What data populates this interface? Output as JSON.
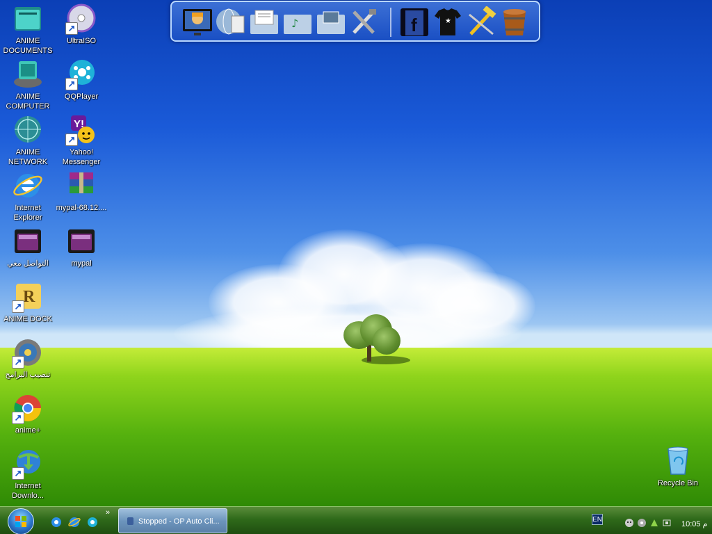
{
  "desktop": {
    "icons_col1": [
      {
        "label": "ANIME DOCUMENTS",
        "icon": "folder-icon"
      },
      {
        "label": "ANIME COMPUTER",
        "icon": "computer-icon"
      },
      {
        "label": "ANIME NETWORK",
        "icon": "network-globe-icon"
      },
      {
        "label": "Internet Explorer",
        "icon": "internet-explorer-icon"
      },
      {
        "label": "التواصل معي",
        "icon": "dark-folder-icon"
      },
      {
        "label": "ANIME DOCK",
        "icon": "rocketdock-icon"
      },
      {
        "label": "تنصيب البرامج",
        "icon": "installer-icon"
      },
      {
        "label": "anime+",
        "icon": "chrome-icon"
      },
      {
        "label": "Internet Downlo...",
        "icon": "internet-download-manager-icon"
      }
    ],
    "icons_col2": [
      {
        "label": "UltraISO",
        "icon": "disc-icon"
      },
      {
        "label": "QQPlayer",
        "icon": "film-reel-icon"
      },
      {
        "label": "Yahoo! Messenger",
        "icon": "yahoo-messenger-icon"
      },
      {
        "label": "mypal-68.12....",
        "icon": "winrar-archive-icon"
      },
      {
        "label": "mypal",
        "icon": "dark-folder-icon"
      }
    ],
    "recycle_bin": {
      "label": "Recycle Bin",
      "icon": "recycle-bin-icon"
    }
  },
  "dock": {
    "items": [
      {
        "icon": "anime-computer-icon"
      },
      {
        "icon": "globe-documents-icon"
      },
      {
        "icon": "documents-folder-icon"
      },
      {
        "icon": "music-folder-icon"
      },
      {
        "icon": "pictures-folder-icon"
      },
      {
        "icon": "tools-icon"
      },
      {
        "icon": "facebook-icon"
      },
      {
        "icon": "tshirt-icon"
      },
      {
        "icon": "hammer-icon"
      },
      {
        "icon": "bucket-icon"
      }
    ]
  },
  "taskbar": {
    "task_button_label": "Stopped - OP Auto Cli...",
    "language": "EN",
    "clock": "10:05 م",
    "quick_launch": [
      {
        "icon": "ie-quicklaunch-icon"
      },
      {
        "icon": "ie-quicklaunch-icon-2"
      },
      {
        "icon": "app-quicklaunch-icon"
      }
    ]
  }
}
